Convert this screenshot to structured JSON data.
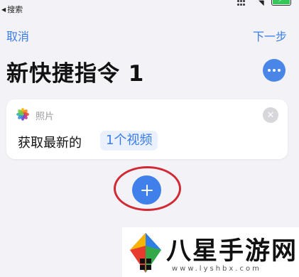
{
  "status_bar": {
    "back_app": "搜索",
    "back_icon": "back-triangle-icon",
    "wifi_icon": "wifi-icon",
    "battery_icon": "battery-charging-icon"
  },
  "nav": {
    "cancel": "取消",
    "next": "下一步"
  },
  "title": "新快捷指令 1",
  "more_icon": "ellipsis-icon",
  "action_card": {
    "app_label": "照片",
    "app_icon": "photos-icon",
    "action_text": "获取最新的",
    "parameter": "1个视频",
    "close_icon": "close-icon"
  },
  "add_button": {
    "icon": "plus-icon",
    "highlight_color": "#d12a35"
  },
  "watermark": {
    "title": "八星手游网",
    "url": "www.lyshbx.com"
  },
  "colors": {
    "accent": "#3a7ce9",
    "background": "#f2f2f7",
    "card": "#ffffff"
  }
}
